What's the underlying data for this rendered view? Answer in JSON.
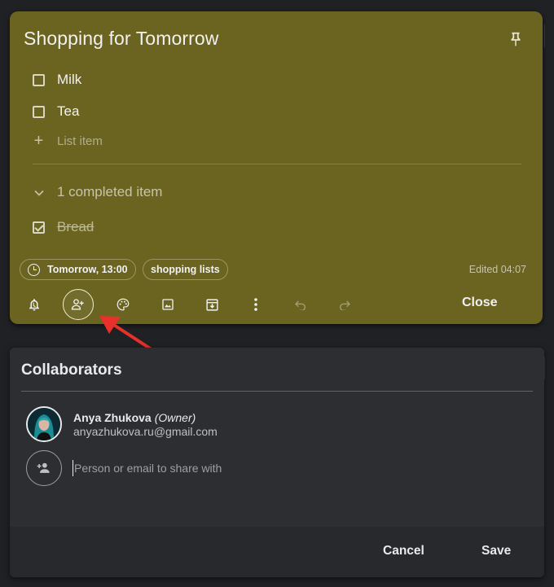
{
  "note": {
    "title": "Shopping for Tomorrow",
    "items": [
      {
        "text": "Milk",
        "checked": false
      },
      {
        "text": "Tea",
        "checked": false
      }
    ],
    "add_item_placeholder": "List item",
    "completed_toggle": "1 completed item",
    "completed_items": [
      {
        "text": "Bread",
        "checked": true
      }
    ],
    "reminder_chip": "Tomorrow, 13:00",
    "label_chip": "shopping lists",
    "edited": "Edited 04:07",
    "toolbar": {
      "icons": [
        "remind-me-icon",
        "collaborator-icon",
        "palette-icon",
        "image-icon",
        "archive-icon",
        "more-icon",
        "undo-icon",
        "redo-icon"
      ],
      "close_label": "Close"
    },
    "color": "#6b6420"
  },
  "collaborators": {
    "title": "Collaborators",
    "owner": {
      "name": "Anya Zhukova",
      "role": "(Owner)",
      "email": "anyazhukova.ru@gmail.com"
    },
    "share_placeholder": "Person or email to share with",
    "cancel_label": "Cancel",
    "save_label": "Save"
  },
  "annotation": {
    "arrow_color": "#e8312a",
    "points_to": "collaborator-icon"
  }
}
